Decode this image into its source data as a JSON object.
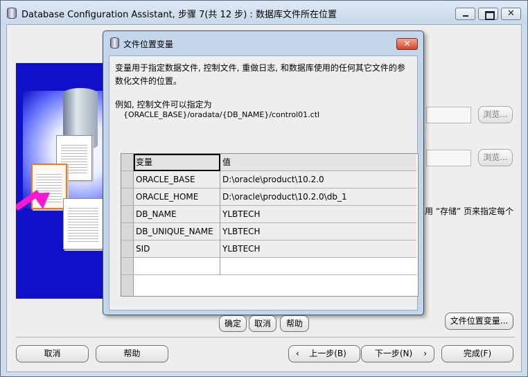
{
  "main_window": {
    "title": "Database Configuration Assistant, 步骤 7(共 12 步) : 数据库文件所在位置",
    "title_controls": {
      "close": "✕"
    },
    "background": {
      "browse_1": "浏览...",
      "browse_2": "浏览...",
      "partial_text": "用 “存储” 页来指定每个",
      "file_location_variables_button": "文件位置变量..."
    },
    "footer": {
      "cancel": "取消",
      "help": "帮助",
      "back": "上一步(B)",
      "next": "下一步(N)",
      "finish": "完成(F)"
    }
  },
  "dialog": {
    "title": "文件位置变量",
    "close_glyph": "✕",
    "description": "变量用于指定数据文件, 控制文件, 重做日志, 和数据库使用的任何其它文件的参数化文件的位置。",
    "example_label": "例如, 控制文件可以指定为",
    "example_path": "{ORACLE_BASE}/oradata/{DB_NAME}/control01.ctl",
    "table": {
      "headers": {
        "variable": "变量",
        "value": "值"
      },
      "rows": [
        {
          "variable": "ORACLE_BASE",
          "value": "D:\\oracle\\product\\10.2.0"
        },
        {
          "variable": "ORACLE_HOME",
          "value": "D:\\oracle\\product\\10.2.0\\db_1"
        },
        {
          "variable": "DB_NAME",
          "value": "YLBTECH"
        },
        {
          "variable": "DB_UNIQUE_NAME",
          "value": "YLBTECH"
        },
        {
          "variable": "SID",
          "value": "YLBTECH"
        }
      ]
    },
    "buttons": {
      "ok": "确定",
      "cancel": "取消",
      "help": "帮助"
    }
  },
  "colors": {
    "title_bar": "#c7d8ea",
    "client_bg": "#eeeeee",
    "illustration_bg": "#1010c8",
    "close_button": "#d4472a",
    "arrow": "#f21bd0"
  }
}
